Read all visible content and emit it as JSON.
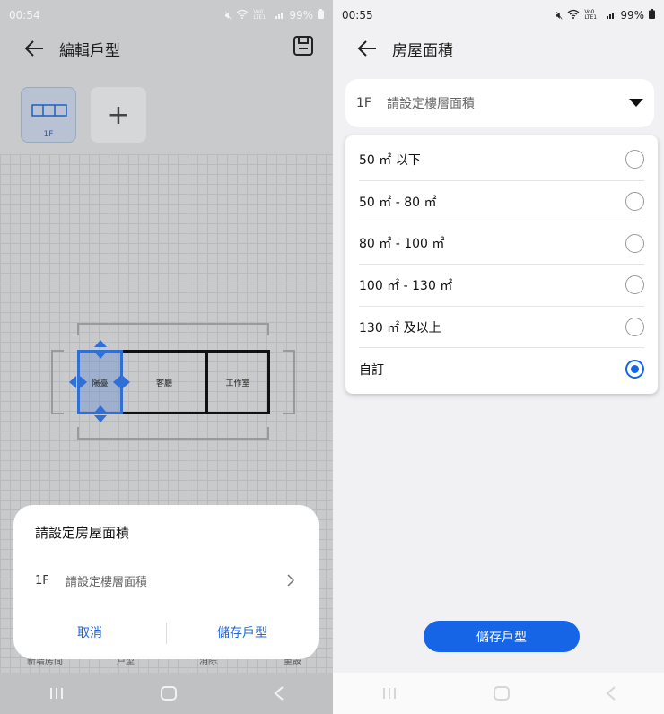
{
  "left": {
    "status": {
      "time": "00:54",
      "battery": "99%",
      "net": "Vo0 LTE1"
    },
    "title": "編輯戶型",
    "floor_tab_label": "1F",
    "add_label": "+",
    "rooms": {
      "balcony": "陽臺",
      "living": "客廳",
      "studio": "工作室"
    },
    "bottom_nav": [
      "新增房間",
      "戶型",
      "消除",
      "重設"
    ],
    "dialog": {
      "title": "請設定房屋面積",
      "floor": "1F",
      "placeholder": "請設定樓層面積",
      "cancel": "取消",
      "save": "儲存戶型"
    }
  },
  "right": {
    "status": {
      "time": "00:55",
      "battery": "99%",
      "net": "Vo0 LTE1"
    },
    "title": "房屋面積",
    "select": {
      "floor": "1F",
      "placeholder": "請設定樓層面積"
    },
    "options": [
      "50 ㎡ 以下",
      "50 ㎡ - 80 ㎡",
      "80 ㎡ - 100 ㎡",
      "100 ㎡ - 130 ㎡",
      "130 ㎡ 及以上",
      "自訂"
    ],
    "selected_index": 5,
    "save": "儲存戶型"
  },
  "colors": {
    "accent": "#1565e6",
    "selected_room": "#2f6fd6"
  }
}
